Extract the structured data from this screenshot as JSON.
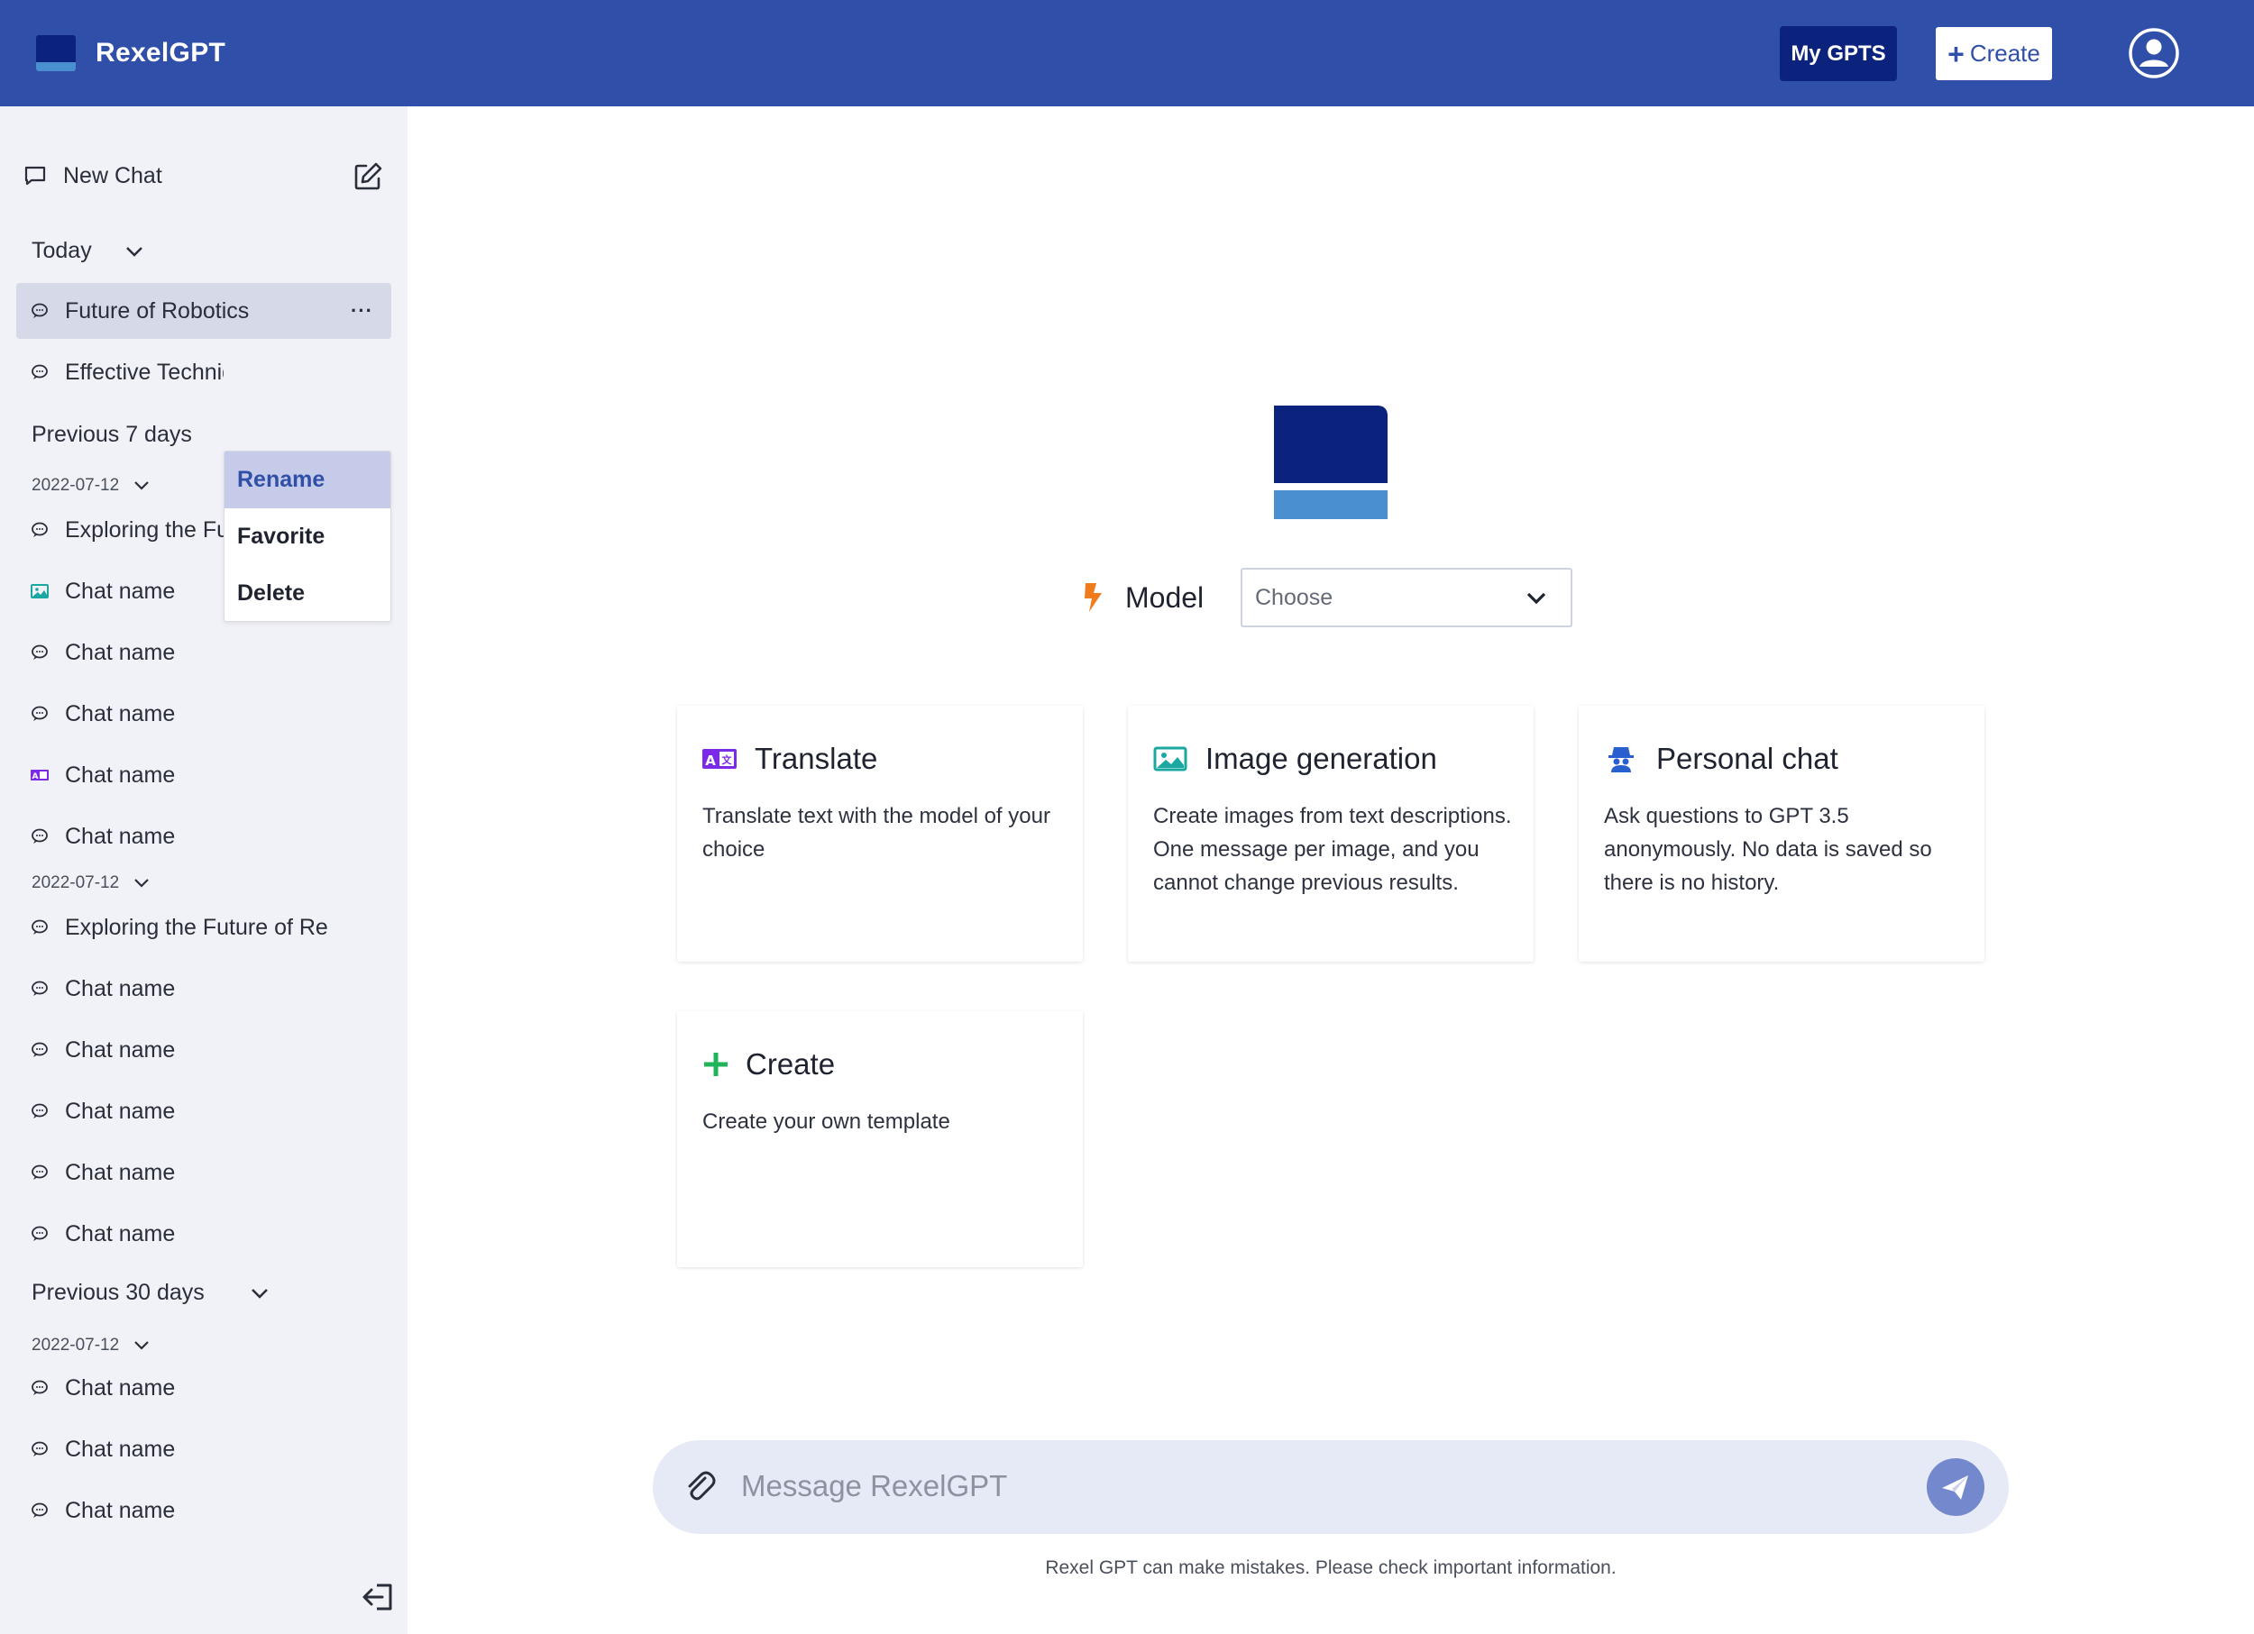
{
  "header": {
    "brand": "RexelGPT",
    "my_gpts": "My GPTS",
    "create_plus": "+",
    "create": "Create",
    "colors": {
      "bar": "#304fa8",
      "dark": "#0b237d",
      "light": "#4a8fd0"
    }
  },
  "sidebar": {
    "new_chat": "New Chat",
    "today": "Today",
    "today_items": [
      {
        "label": "Future of Robotics",
        "icon": "chat-bubble-icon",
        "more": "···"
      },
      {
        "label": "Effective Techniques",
        "icon": "chat-bubble-icon"
      }
    ],
    "context_menu": [
      "Rename",
      "Favorite",
      "Delete"
    ],
    "previous7": "Previous 7 days",
    "date_a": "2022-07-12",
    "group_a": [
      {
        "label": "Exploring the Future of Re",
        "icon": "chat-bubble-icon"
      },
      {
        "label": "Chat name",
        "icon": "image-icon"
      },
      {
        "label": "Chat name",
        "icon": "chat-bubble-icon"
      },
      {
        "label": "Chat name",
        "icon": "chat-bubble-icon"
      },
      {
        "label": "Chat name",
        "icon": "translate-icon"
      },
      {
        "label": "Chat name",
        "icon": "chat-bubble-icon"
      }
    ],
    "date_b": "2022-07-12",
    "group_b": [
      {
        "label": "Exploring the Future of Re",
        "icon": "chat-bubble-icon"
      },
      {
        "label": "Chat name",
        "icon": "chat-bubble-icon"
      },
      {
        "label": "Chat name",
        "icon": "chat-bubble-icon"
      },
      {
        "label": "Chat name",
        "icon": "chat-bubble-icon"
      },
      {
        "label": "Chat name",
        "icon": "chat-bubble-icon"
      },
      {
        "label": "Chat name",
        "icon": "chat-bubble-icon"
      }
    ],
    "previous30": "Previous 30 days",
    "date_c": "2022-07-12",
    "group_c": [
      {
        "label": "Chat name",
        "icon": "chat-bubble-icon"
      },
      {
        "label": "Chat name",
        "icon": "chat-bubble-icon"
      },
      {
        "label": "Chat name",
        "icon": "chat-bubble-icon"
      }
    ]
  },
  "main": {
    "model_label": "Model",
    "model_select": "Choose",
    "cards": [
      {
        "title": "Translate",
        "desc": "Translate text with the model of your choice",
        "icon": "translate-icon"
      },
      {
        "title": "Image generation",
        "desc": "Create images from text descriptions. One message per image, and you cannot change previous results.",
        "icon": "image-icon"
      },
      {
        "title": "Personal chat",
        "desc": "Ask questions to GPT 3.5 anonymously. No data is saved so there is no history.",
        "icon": "incognito-icon"
      },
      {
        "title": "Create",
        "desc": "Create your own template",
        "icon": "plus-icon"
      }
    ],
    "composer_placeholder": "Message RexelGPT",
    "footer_note": "Rexel GPT can make mistakes. Please check important information."
  }
}
